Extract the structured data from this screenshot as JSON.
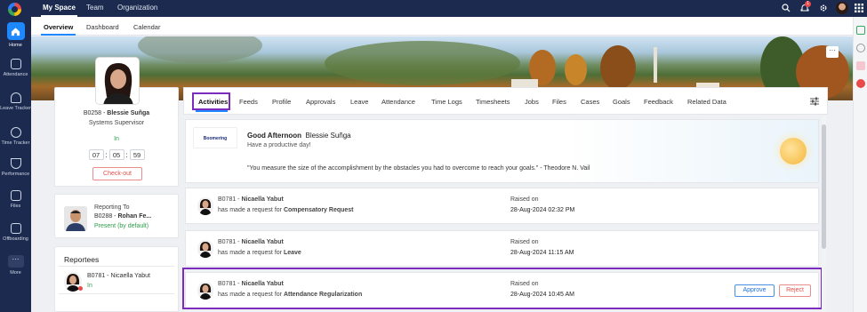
{
  "leftnav": {
    "items": [
      {
        "label": "Home",
        "icon": "home-icon"
      },
      {
        "label": "Attendance",
        "icon": "calendar-icon"
      },
      {
        "label": "Leave Tracker",
        "icon": "leave-icon"
      },
      {
        "label": "Time Tracker",
        "icon": "clock-icon"
      },
      {
        "label": "Performance",
        "icon": "trophy-icon"
      },
      {
        "label": "Files",
        "icon": "folder-icon"
      },
      {
        "label": "Offboarding",
        "icon": "exit-icon"
      },
      {
        "label": "More",
        "icon": "more-icon"
      }
    ]
  },
  "topbar": {
    "tabs": [
      "My Space",
      "Team",
      "Organization"
    ],
    "notification_count": "1"
  },
  "subtabs": [
    "Overview",
    "Dashboard",
    "Calendar"
  ],
  "profile": {
    "id_name": "B0258 - ",
    "name": "Blessie Suñga",
    "title": "Systems Supervisor",
    "status": "In",
    "time": {
      "h": "07",
      "m": "05",
      "s": "59"
    },
    "checkout_label": "Check-out"
  },
  "reporting": {
    "label": "Reporting To",
    "id": "B0288 - ",
    "name": "Rohan Fe...",
    "status": "Present (by default)"
  },
  "reportees": {
    "title": "Reportees",
    "items": [
      {
        "id": "B0781 - ",
        "name": "Nicaella Yabut",
        "status": "In"
      }
    ]
  },
  "activity_tabs": [
    "Activities",
    "Feeds",
    "Profile",
    "Approvals",
    "Leave",
    "Attendance",
    "Time Logs",
    "Timesheets",
    "Jobs",
    "Files",
    "Cases",
    "Goals",
    "Feedback",
    "Related Data"
  ],
  "greeting": {
    "logo_text": "Boomering",
    "title": "Good Afternoon",
    "name": "Blessie Suñga",
    "subtitle": "Have a productive day!",
    "quote": "\"You measure the size of the accomplishment by the obstacles you had to overcome to reach your goals.\" - Theodore N. Vail"
  },
  "requests": [
    {
      "id": "B0781 - ",
      "name": "Nicaella Yabut",
      "prefix": "has made a request for ",
      "type": "Compensatory Request",
      "raised_label": "Raised on",
      "date": "28-Aug-2024 02:32 PM"
    },
    {
      "id": "B0781 - ",
      "name": "Nicaella Yabut",
      "prefix": "has made a request for ",
      "type": "Leave",
      "raised_label": "Raised on",
      "date": "28-Aug-2024 11:15 AM"
    },
    {
      "id": "B0781 - ",
      "name": "Nicaella Yabut",
      "prefix": "has made a request for ",
      "type": "Attendance Regularization",
      "raised_label": "Raised on",
      "date": "28-Aug-2024 10:45 AM",
      "approve": "Approve",
      "reject": "Reject"
    }
  ],
  "banner_more": "···",
  "colors": {
    "nav_bg": "#1b2a4e",
    "accent": "#1e88ff",
    "highlight": "#7b2cbf",
    "success": "#2e9d4b",
    "danger": "#e0504a"
  }
}
